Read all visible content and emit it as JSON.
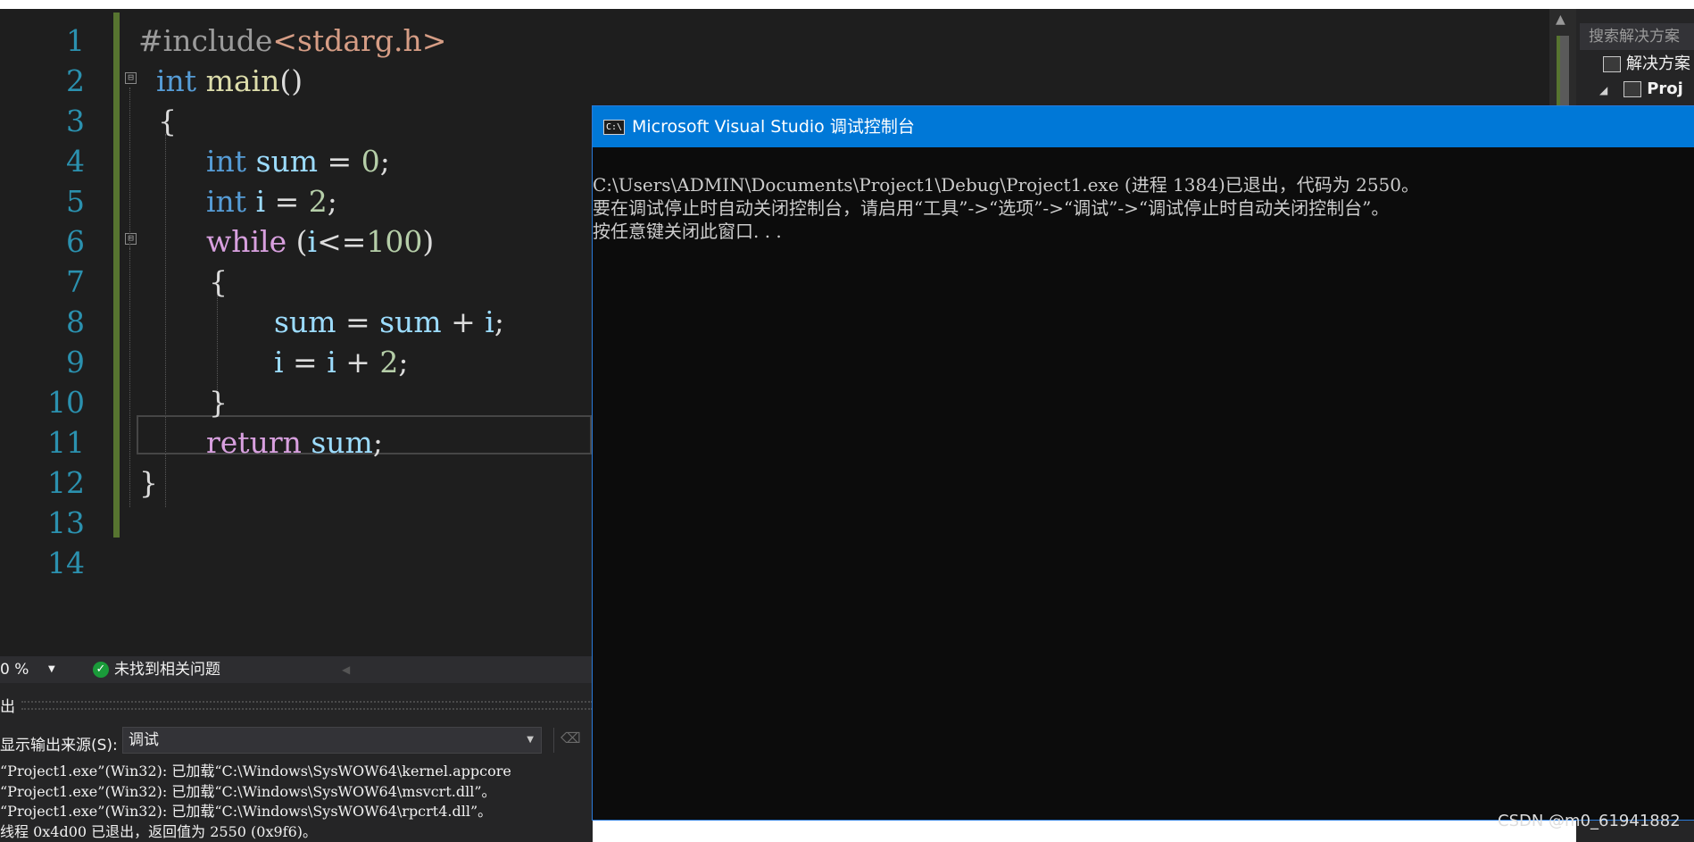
{
  "editor": {
    "line_numbers": [
      "1",
      "2",
      "3",
      "4",
      "5",
      "6",
      "7",
      "8",
      "9",
      "10",
      "11",
      "12",
      "13",
      "14"
    ],
    "code": {
      "l1_pp": "#include",
      "l1_inc": "<stdarg.h>",
      "l2_kw": "int",
      "l2_fn": "main",
      "l2_rest": "()",
      "l3": "{",
      "l4_kw": "int",
      "l4_var": "sum",
      "l4_eq": " = ",
      "l4_num": "0",
      "l4_end": ";",
      "l5_kw": "int",
      "l5_var": "i",
      "l5_eq": " = ",
      "l5_num": "2",
      "l5_end": ";",
      "l6_kw": "while",
      "l6_open": " (",
      "l6_var": "i",
      "l6_op": "<=",
      "l6_num": "100",
      "l6_close": ")",
      "l7": "{",
      "l8_a": "sum",
      "l8_eq": " = ",
      "l8_b": "sum",
      "l8_plus": " + ",
      "l8_c": "i",
      "l8_end": ";",
      "l9_a": "i",
      "l9_eq": " = ",
      "l9_b": "i",
      "l9_plus": " + ",
      "l9_num": "2",
      "l9_end": ";",
      "l10": "}",
      "l11_kw": "return",
      "l11_var": "sum",
      "l11_end": ";",
      "l12": "}"
    },
    "fold_symbol": "⊟"
  },
  "status_strip": {
    "zoom": "0 %",
    "issues_label": "未找到相关问题",
    "check_glyph": "✓"
  },
  "output_panel": {
    "title": "出",
    "source_label": "显示输出来源(S):",
    "source_value": "调试",
    "lines": [
      "“Project1.exe”(Win32): 已加载“C:\\Windows\\SysWOW64\\kernel.appcore",
      "“Project1.exe”(Win32): 已加载“C:\\Windows\\SysWOW64\\msvcrt.dll”。",
      "“Project1.exe”(Win32): 已加载“C:\\Windows\\SysWOW64\\rpcrt4.dll”。",
      "线程 0x4d00 已退出，返回值为 2550 (0x9f6)。"
    ]
  },
  "console": {
    "title": "Microsoft Visual Studio 调试控制台",
    "icon_text": "C:\\",
    "lines": [
      "C:\\Users\\ADMIN\\Documents\\Project1\\Debug\\Project1.exe (进程 1384)已退出，代码为 2550。",
      "要在调试停止时自动关闭控制台，请启用“工具”->“选项”->“调试”->“调试停止时自动关闭控制台”。",
      "按任意键关闭此窗口. . ."
    ]
  },
  "solution_explorer": {
    "search_placeholder": "搜索解决方案",
    "items": [
      "解决方案",
      "Proj"
    ]
  },
  "watermark": "CSDN @m0_61941882",
  "colors": {
    "editor_bg": "#1e1e1e",
    "keyword": "#569cd6",
    "control_keyword": "#d8a0df",
    "number": "#b5cea8",
    "console_titlebar": "#0078d7",
    "change_bar": "#577430"
  }
}
